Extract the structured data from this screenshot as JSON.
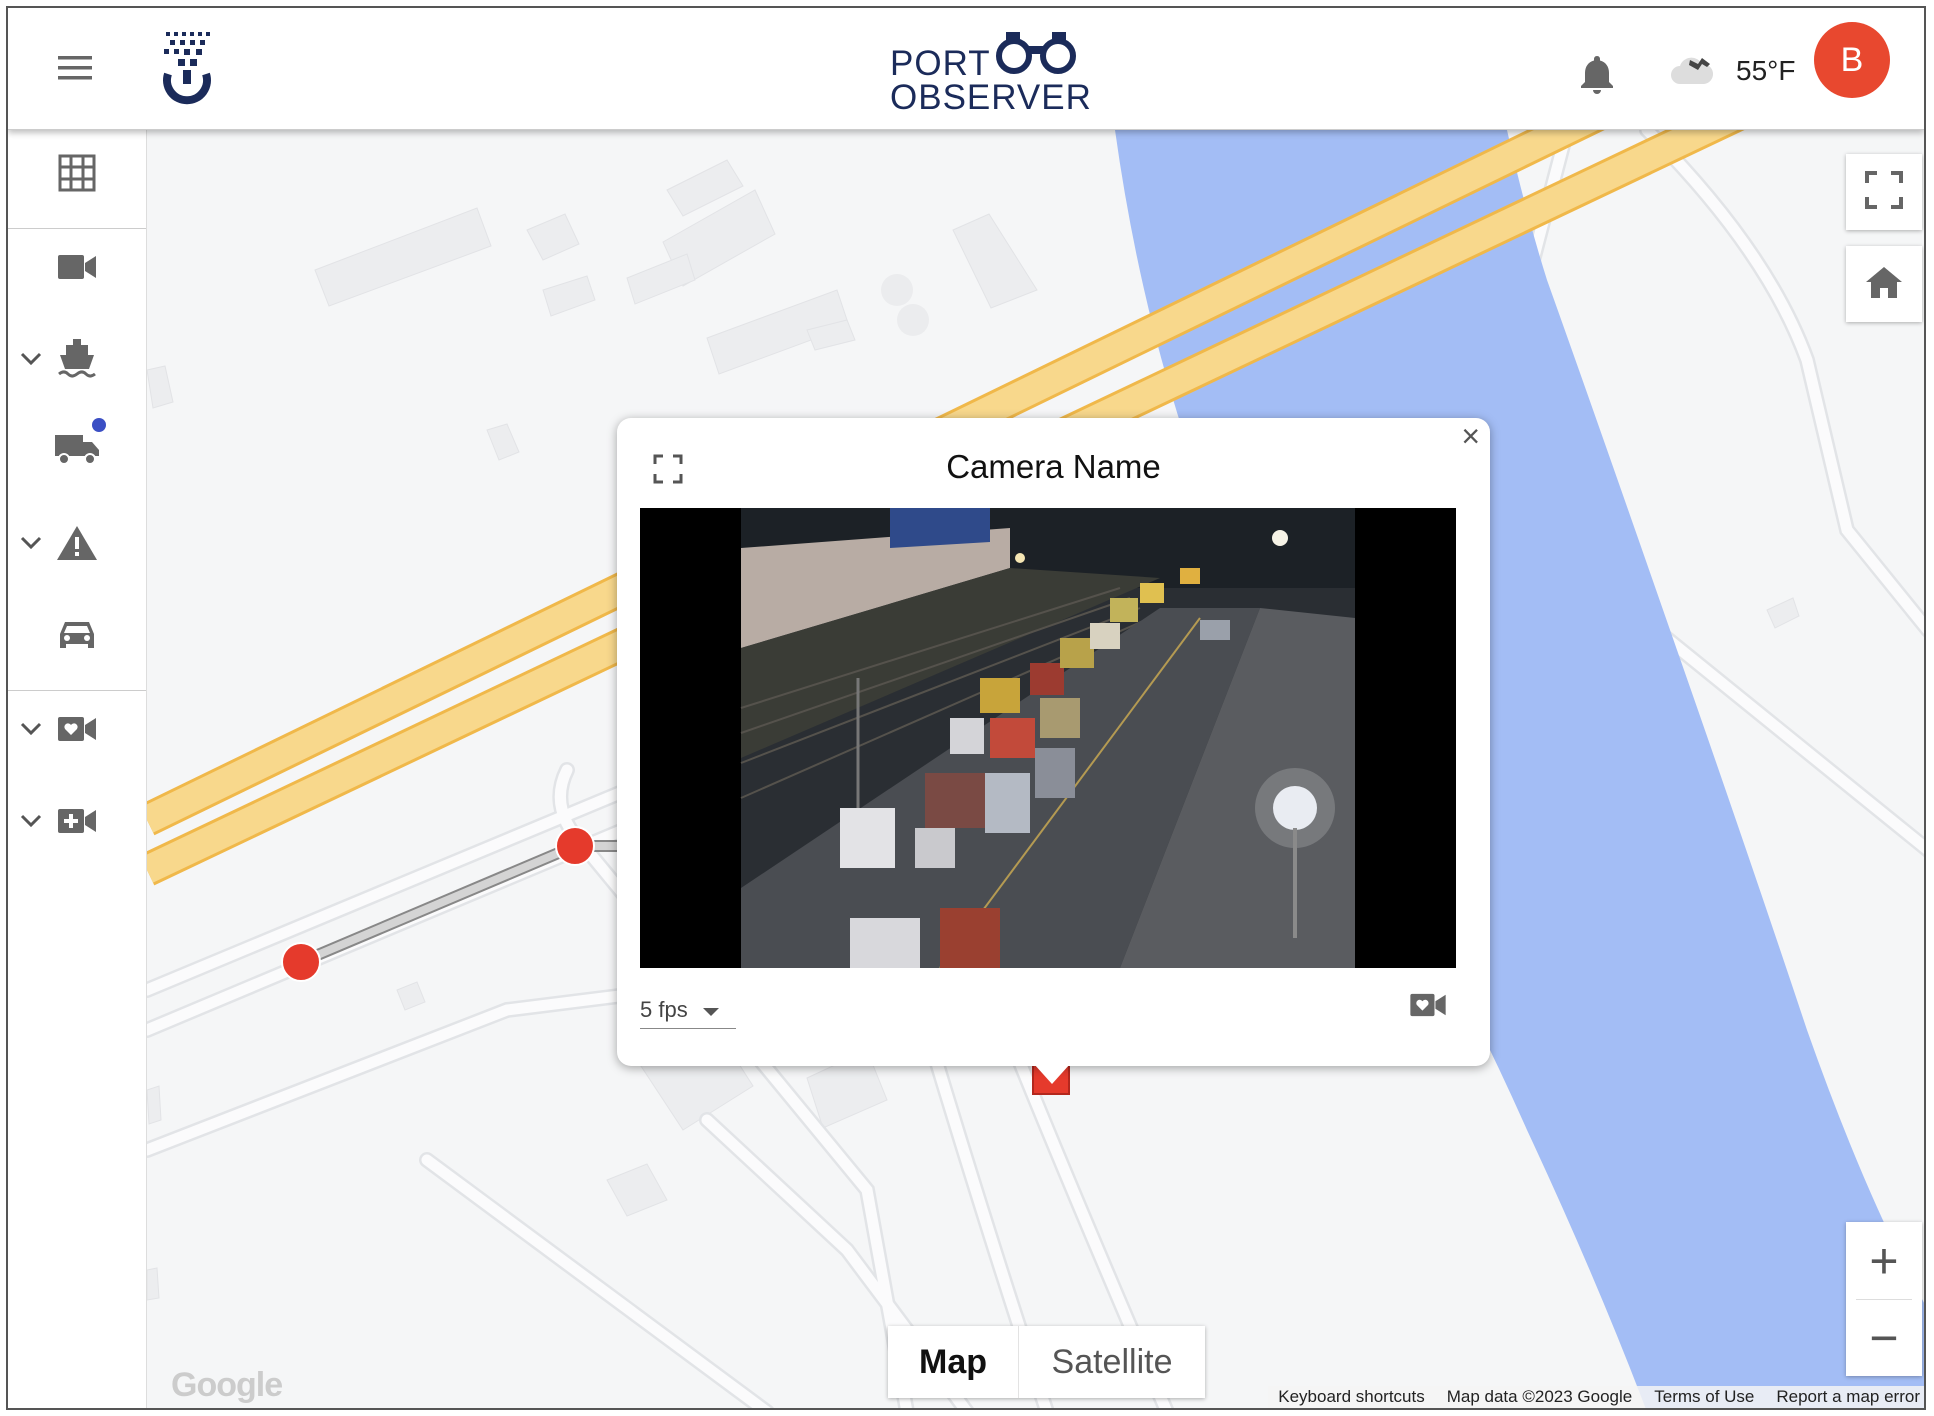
{
  "app": {
    "brand_line1": "PORT",
    "brand_line2": "OBSERVER"
  },
  "header": {
    "menu_icon": "hamburger-menu-icon",
    "logo_icon": "company-logo-icon",
    "notification_icon": "bell-icon",
    "weather_icon": "cloud-icon",
    "temperature": "55°F",
    "avatar_initial": "B",
    "avatar_color": "#e8482f"
  },
  "sidebar": {
    "items": [
      {
        "icon": "grid-icon",
        "expandable": false
      },
      {
        "icon": "camera-icon",
        "expandable": false
      },
      {
        "icon": "ship-icon",
        "expandable": true
      },
      {
        "icon": "truck-icon",
        "expandable": false,
        "badge": true
      },
      {
        "icon": "warning-icon",
        "expandable": true
      },
      {
        "icon": "car-icon",
        "expandable": false
      },
      {
        "icon": "favorite-camera-icon",
        "expandable": true
      },
      {
        "icon": "add-camera-icon",
        "expandable": true
      }
    ],
    "badge_color": "#3b4fc4"
  },
  "map": {
    "colors": {
      "water": "#a3bdf5",
      "highway": "#f8d88c",
      "highway_edge": "#f0b84a",
      "marker": "#e53a2c"
    },
    "controls": {
      "fullscreen_icon": "fullscreen-icon",
      "home_icon": "home-icon",
      "zoom_in": "+",
      "zoom_out": "−"
    },
    "map_type": {
      "map_label": "Map",
      "satellite_label": "Satellite"
    },
    "google_logo": "Google",
    "attribution": {
      "shortcuts": "Keyboard shortcuts",
      "data": "Map data ©2023 Google",
      "terms": "Terms of Use",
      "report": "Report a map error"
    }
  },
  "popup": {
    "title": "Camera Name",
    "close_label": "×",
    "expand_icon": "fullscreen-icon",
    "fps_value": "5 fps",
    "favorite_icon": "favorite-camera-icon"
  }
}
